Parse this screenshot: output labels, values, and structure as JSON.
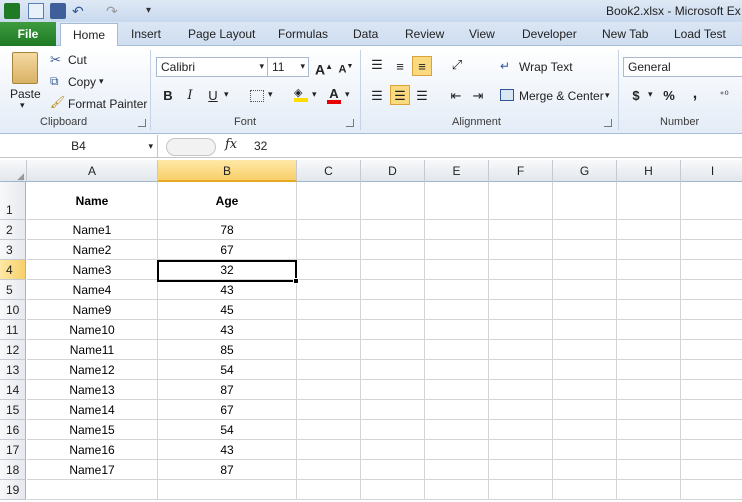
{
  "window": {
    "title": "Book2.xlsx - Microsoft Ex"
  },
  "tabs": {
    "file": "File",
    "items": [
      "Home",
      "Insert",
      "Page Layout",
      "Formulas",
      "Data",
      "Review",
      "View",
      "Developer",
      "New Tab",
      "Load Test"
    ]
  },
  "clipboard": {
    "paste": "Paste",
    "cut": "Cut",
    "copy": "Copy",
    "format_painter": "Format Painter",
    "label": "Clipboard"
  },
  "font": {
    "name": "Calibri",
    "size": "11",
    "label": "Font",
    "bold": "B",
    "italic": "I",
    "underline": "U"
  },
  "alignment": {
    "wrap": "Wrap Text",
    "merge": "Merge & Center",
    "label": "Alignment"
  },
  "number": {
    "format": "General",
    "currency": "$",
    "percent": "%",
    "comma": ",",
    "label": "Number"
  },
  "formula_bar": {
    "name_box": "B4",
    "fx": "fx",
    "value": "32"
  },
  "sheet": {
    "columns": [
      "A",
      "B",
      "C",
      "D",
      "E",
      "F",
      "G",
      "H",
      "I"
    ],
    "header": [
      "Name",
      "Age"
    ],
    "row_numbers": [
      "1",
      "2",
      "3",
      "4",
      "5",
      "10",
      "11",
      "12",
      "13",
      "14",
      "15",
      "16",
      "17",
      "18",
      "19"
    ],
    "rows": [
      [
        "Name1",
        "78"
      ],
      [
        "Name2",
        "67"
      ],
      [
        "Name3",
        "32"
      ],
      [
        "Name4",
        "43"
      ],
      [
        "Name9",
        "45"
      ],
      [
        "Name10",
        "43"
      ],
      [
        "Name11",
        "85"
      ],
      [
        "Name12",
        "54"
      ],
      [
        "Name13",
        "87"
      ],
      [
        "Name14",
        "67"
      ],
      [
        "Name15",
        "54"
      ],
      [
        "Name16",
        "43"
      ],
      [
        "Name17",
        "87"
      ]
    ]
  },
  "colors": {
    "file_tab": "#1f7a25",
    "selection": "#f8cf6a"
  }
}
